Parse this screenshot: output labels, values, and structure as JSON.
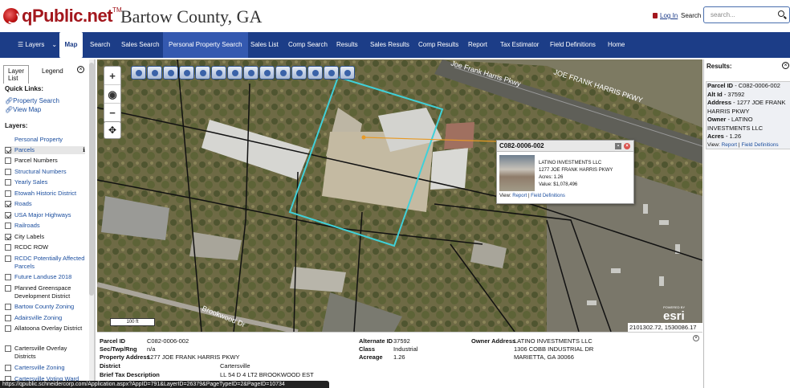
{
  "header": {
    "brand": "qPublic.net",
    "trademark": "TM",
    "county": "Bartow County, GA",
    "login": "Log In",
    "search_label": "Search",
    "search_placeholder": "search..."
  },
  "nav": {
    "items": [
      "Layers",
      "Map",
      "Search",
      "Sales Search",
      "Personal Property Search",
      "Sales List",
      "Comp Search",
      "Results",
      "Sales Results",
      "Comp Results",
      "Report",
      "Tax Estimator",
      "Field Definitions",
      "Home"
    ],
    "active": "Personal Property Search"
  },
  "left": {
    "tabs": [
      "Layer List",
      "Legend"
    ],
    "quick_links_title": "Quick Links:",
    "quick_links": [
      "Property Search",
      "View Map"
    ],
    "layers_title": "Layers:",
    "layers": [
      {
        "label": "Personal Property",
        "checkbox": false,
        "checked": false,
        "link": true
      },
      {
        "label": "Parcels",
        "checkbox": true,
        "checked": true,
        "link": true
      },
      {
        "label": "Parcel Numbers",
        "checkbox": true,
        "checked": false,
        "link": false
      },
      {
        "label": "Structural Numbers",
        "checkbox": true,
        "checked": false,
        "link": true
      },
      {
        "label": "Yearly Sales",
        "checkbox": true,
        "checked": false,
        "link": true
      },
      {
        "label": "Etowah Historic District",
        "checkbox": true,
        "checked": false,
        "link": true
      },
      {
        "label": "Roads",
        "checkbox": true,
        "checked": true,
        "link": true
      },
      {
        "label": "USA Major Highways",
        "checkbox": true,
        "checked": true,
        "link": true
      },
      {
        "label": "Railroads",
        "checkbox": true,
        "checked": false,
        "link": true
      },
      {
        "label": "City Labels",
        "checkbox": true,
        "checked": true,
        "link": false
      },
      {
        "label": "RCDC ROW",
        "checkbox": true,
        "checked": false,
        "link": false
      },
      {
        "label": "RCDC Potentially Affected Parcels",
        "checkbox": true,
        "checked": false,
        "link": true
      },
      {
        "label": "Future Landuse 2018",
        "checkbox": true,
        "checked": false,
        "link": true
      },
      {
        "label": "Planned Greenspace Development District",
        "checkbox": true,
        "checked": false,
        "link": false
      },
      {
        "label": "Bartow County Zoning",
        "checkbox": true,
        "checked": false,
        "link": true
      },
      {
        "label": "Adairsville Zoning",
        "checkbox": true,
        "checked": false,
        "link": true
      },
      {
        "label": "Allatoona Overlay District",
        "checkbox": true,
        "checked": false,
        "link": false
      },
      {
        "label": "Cartersville Overlay Districts",
        "checkbox": true,
        "checked": false,
        "link": false
      },
      {
        "label": "Cartersville Zoning",
        "checkbox": true,
        "checked": false,
        "link": true
      },
      {
        "label": "Cartersville Voting Ward",
        "checkbox": true,
        "checked": false,
        "link": true
      }
    ]
  },
  "map": {
    "roads": [
      "Joe Frank Harris Pkwy",
      "JOE FRANK HARRIS PKWY",
      "Brookwood Dr"
    ],
    "popup": {
      "title": "C082-0006-002",
      "owner": "LATINO INVESTMENTS LLC",
      "address": "1277 JOE FRANK HARRIS PKWY",
      "acres": "Acres: 1.26",
      "value": "Value: $1,078,496",
      "view": "View:",
      "report": "Report",
      "sep": "|",
      "fielddefs": "Field Definitions"
    },
    "scale": "100 ft",
    "esri_powered": "POWERED BY",
    "esri": "esri",
    "coords": "2101302.72, 1530086.17"
  },
  "bottom": {
    "parcel_id_label": "Parcel ID",
    "parcel_id": "C082-0006-002",
    "sec_label": "Sec/Twp/Rng",
    "sec": "n/a",
    "prop_addr_label": "Property Address",
    "prop_addr": "1277 JOE FRANK HARRIS PKWY",
    "district_label": "District",
    "district": "Cartersville",
    "brief_label": "Brief Tax Description",
    "brief": "LL 54 D 4 LT2 BROOKWOOD EST",
    "alt_label": "Alternate ID",
    "alt": "37592",
    "class_label": "Class",
    "class": "Industrial",
    "acreage_label": "Acreage",
    "acreage": "1.26",
    "owner_label": "Owner Address",
    "owner": "LATINO INVESTMENTS LLC",
    "owner2": "1306 COBB INDUSTRIAL DR",
    "owner3": "MARIETTA, GA 30066"
  },
  "right": {
    "title": "Results:",
    "parcel_label": "Parcel ID",
    "parcel": "- C082-0006-002",
    "alt_label": "Alt Id",
    "alt": "- 37592",
    "addr_label": "Address",
    "addr": "- 1277 JOE FRANK HARRIS PKWY",
    "owner_label": "Owner",
    "owner": "- LATINO INVESTMENTS LLC",
    "acres_label": "Acres",
    "acres": "- 1.26",
    "view": "View:",
    "report": "Report",
    "sep": "|",
    "fielddefs": "Field Definitions"
  },
  "status_url": "https://qpublic.schneidercorp.com/Application.aspx?AppID=791&LayerID=26379&PageTypeID=2&PageID=10734",
  "colors": {
    "nav": "#1c3d87",
    "brand": "#a3171d",
    "parcel_highlight": "#40d0d8",
    "links": "#1a4d9e"
  }
}
